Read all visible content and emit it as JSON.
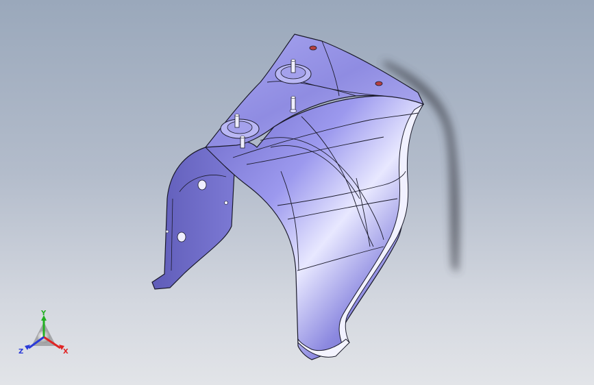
{
  "viewport": {
    "background_top": "#9aa8bb",
    "background_bottom": "#e2e4e8",
    "part_color": "#8a87e4",
    "edge_color": "#1a1a2a",
    "shadow_color": "#3c3f48"
  },
  "triad": {
    "x_label": "X",
    "y_label": "Y",
    "z_label": "Z",
    "x_color": "#e02424",
    "y_color": "#22b022",
    "z_color": "#2a3ad8"
  },
  "icons": [
    "coordinate-triad-icon"
  ]
}
